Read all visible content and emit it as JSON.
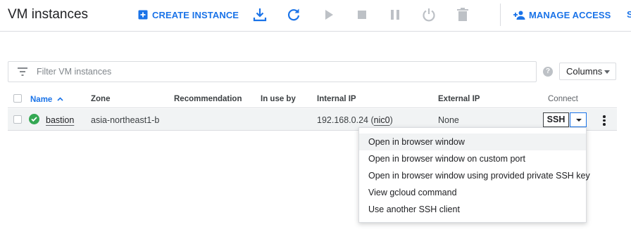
{
  "header": {
    "title": "VM instances",
    "create_instance_label": "CREATE INSTANCE",
    "manage_access_label": "MANAGE ACCESS",
    "overflow_text": "S"
  },
  "toolbar_icons": [
    "import-icon",
    "refresh-icon",
    "start-icon",
    "stop-icon",
    "pause-icon",
    "reset-icon",
    "delete-icon"
  ],
  "filter": {
    "placeholder": "Filter VM instances",
    "value": "",
    "help_glyph": "?",
    "columns_label": "Columns"
  },
  "table": {
    "headers": {
      "name": "Name",
      "zone": "Zone",
      "recommendation": "Recommendation",
      "in_use_by": "In use by",
      "internal_ip": "Internal IP",
      "external_ip": "External IP",
      "connect": "Connect"
    },
    "sort_indicator": "^",
    "rows": [
      {
        "name": "bastion",
        "zone": "asia-northeast1-b",
        "recommendation": "",
        "in_use_by": "",
        "internal_ip": "192.168.0.24",
        "internal_ip_nic": "nic0",
        "external_ip": "None",
        "connect_label": "SSH",
        "status": "running"
      }
    ]
  },
  "ssh_menu": {
    "items": [
      "Open in browser window",
      "Open in browser window on custom port",
      "Open in browser window using provided private SSH key",
      "View gcloud command",
      "Use another SSH client"
    ]
  },
  "colors": {
    "accent": "#1a73e8",
    "status_ok": "#34a853",
    "disabled_icon": "#bdc1c6",
    "row_highlight": "#f1f3f4"
  }
}
